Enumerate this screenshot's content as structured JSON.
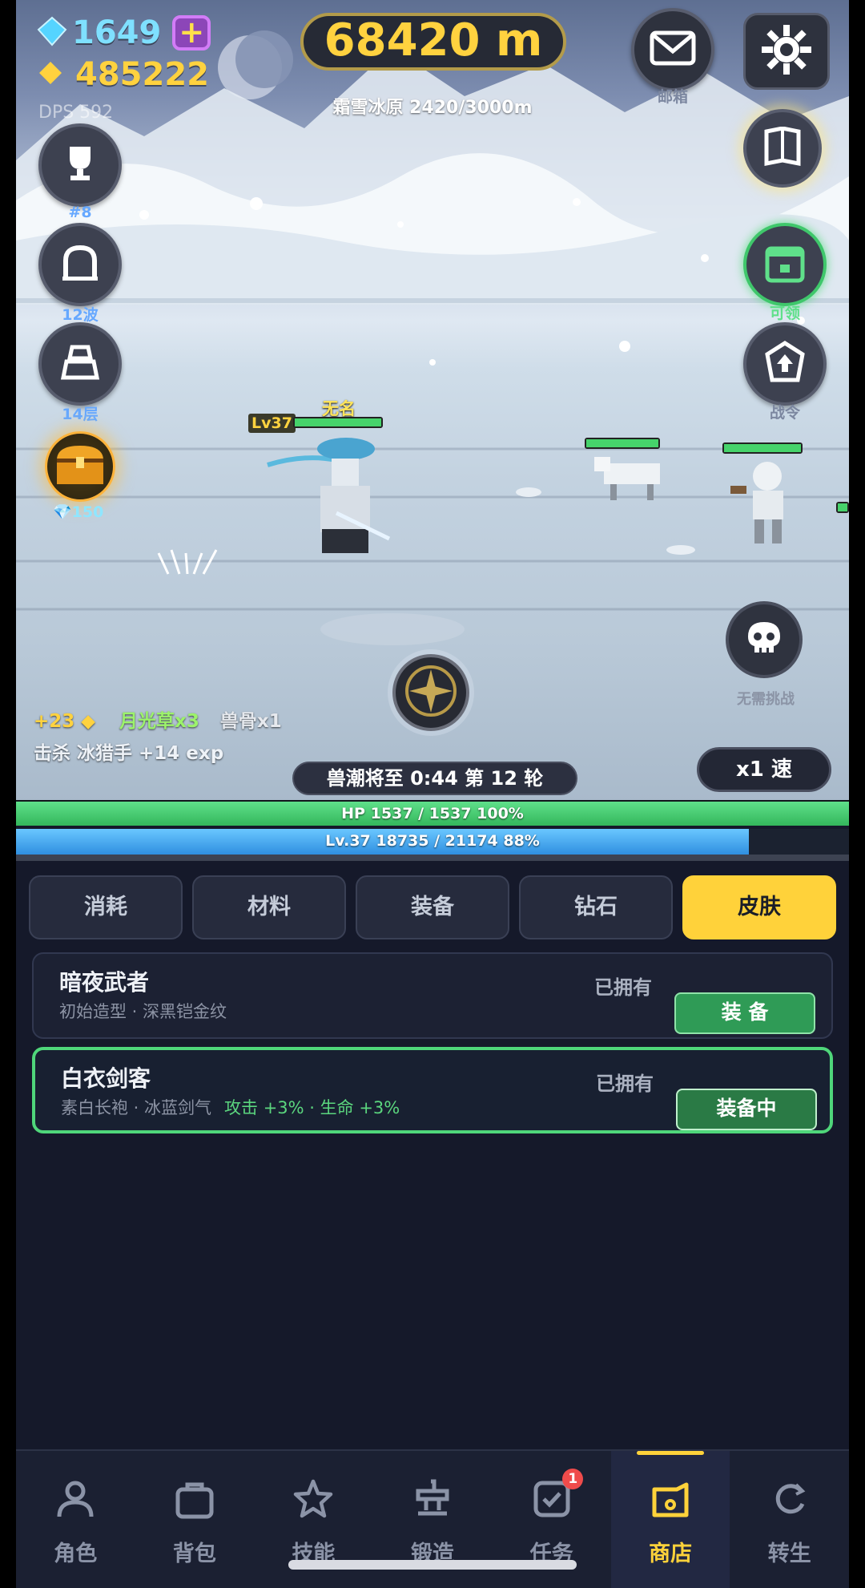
{
  "resources": {
    "gems": "1649",
    "gold": "485222",
    "dps": "DPS 592"
  },
  "distance": "68420 m",
  "zone": "霜雪冰原  2420/3000m",
  "top_buttons": {
    "mail_label": "邮箱"
  },
  "left_buttons": [
    {
      "icon": "trophy-icon",
      "label": "#8"
    },
    {
      "icon": "dungeon-icon",
      "label": "12波"
    },
    {
      "icon": "tower-icon",
      "label": "14层"
    }
  ],
  "chest": {
    "cost": "💎150"
  },
  "right_buttons": [
    {
      "icon": "calendar-icon",
      "label": "可领"
    },
    {
      "icon": "battle-pass-icon",
      "label": "战令"
    }
  ],
  "player": {
    "name": "无名",
    "level": "Lv37"
  },
  "skull_button": {
    "label": "无需挑战"
  },
  "loot": {
    "gold": "+23",
    "herb": "月光草x3",
    "bone": "兽骨x1"
  },
  "kill_log": "击杀 冰猎手  +14 exp",
  "wave_banner": "兽潮将至 0:44   第 12 轮",
  "speed": "x1 速",
  "hp": {
    "text": "HP  1537 / 1537  100%",
    "percent": 100
  },
  "exp": {
    "text": "Lv.37  18735 / 21174  88%",
    "percent": 88
  },
  "shop": {
    "tabs": [
      "消耗",
      "材料",
      "装备",
      "钻石",
      "皮肤"
    ],
    "active_tab": "皮肤",
    "skins": [
      {
        "name": "暗夜武者",
        "desc": "初始造型 · 深黑铠金纹",
        "buff": "",
        "status": "已拥有",
        "button": "装 备",
        "equipped": false
      },
      {
        "name": "白衣剑客",
        "desc": "素白长袍 · 冰蓝剑气",
        "buff": "攻击 +3% · 生命 +3%",
        "status": "已拥有",
        "button": "装备中",
        "equipped": true
      }
    ]
  },
  "nav": [
    {
      "icon": "person-icon",
      "label": "角色"
    },
    {
      "icon": "bag-icon",
      "label": "背包"
    },
    {
      "icon": "star-icon",
      "label": "技能"
    },
    {
      "icon": "anvil-icon",
      "label": "锻造"
    },
    {
      "icon": "task-icon",
      "label": "任务",
      "badge": "1"
    },
    {
      "icon": "shop-icon",
      "label": "商店",
      "active": true
    },
    {
      "icon": "rebirth-icon",
      "label": "转生"
    }
  ],
  "colors": {
    "accent": "#ffd23a",
    "hp": "#46d36b",
    "exp": "#3aa3f0",
    "equipped": "#4fd67a"
  }
}
